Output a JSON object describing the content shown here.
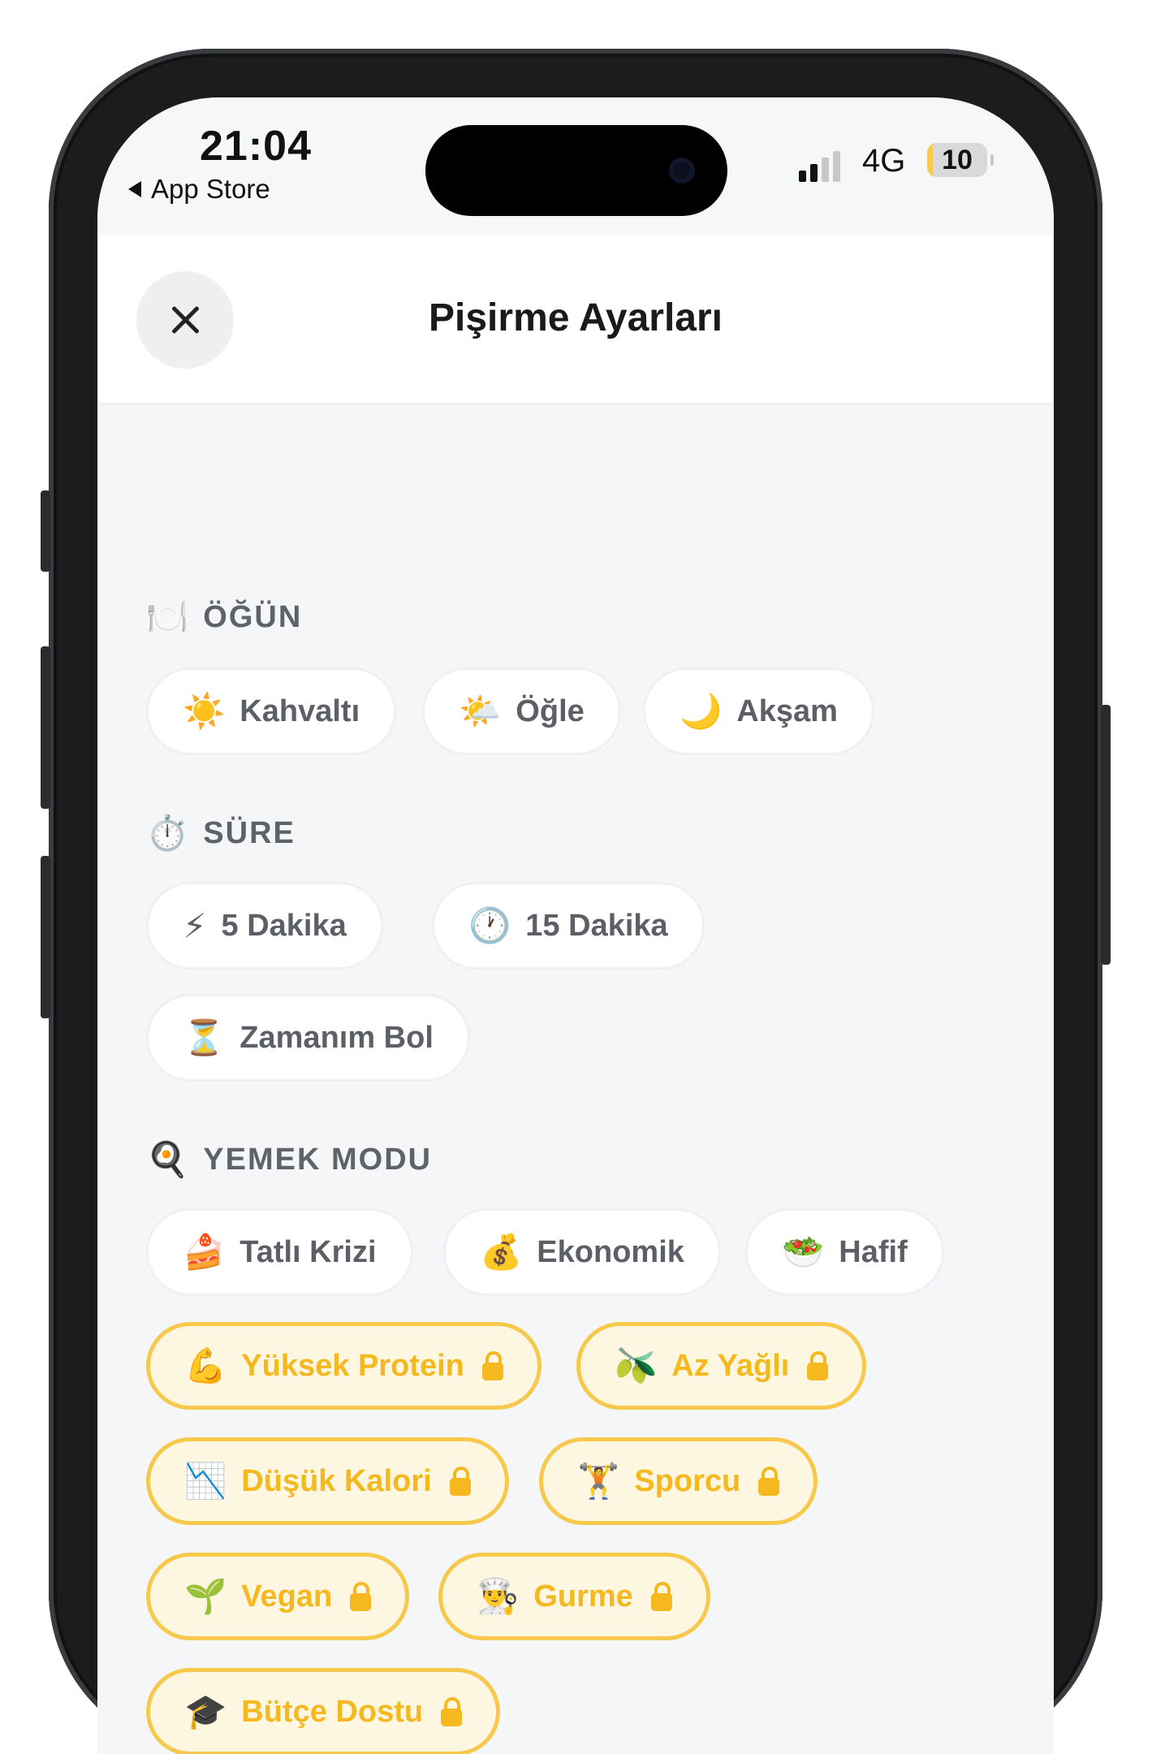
{
  "status": {
    "time": "21:04",
    "back_label": "App Store",
    "network": "4G",
    "battery": "10",
    "battery_level": 0.1,
    "signal_bars": 2
  },
  "header": {
    "title": "Pişirme Ayarları",
    "close_icon": "close-icon"
  },
  "sections": {
    "ogun": {
      "icon": "🍽️",
      "title": "ÖĞÜN",
      "chips": [
        {
          "icon": "☀️",
          "label": "Kahvaltı"
        },
        {
          "icon": "🌤️",
          "label": "Öğle"
        },
        {
          "icon": "🌙",
          "label": "Akşam"
        }
      ]
    },
    "sure": {
      "icon": "⏱️",
      "title": "SÜRE",
      "chips": [
        {
          "icon": "⚡",
          "label": "5 Dakika"
        },
        {
          "icon": "🕐",
          "label": "15 Dakika"
        },
        {
          "icon": "⏳",
          "label": "Zamanım Bol"
        }
      ]
    },
    "mod": {
      "icon": "🍳",
      "title": "YEMEK MODU",
      "chips": [
        {
          "icon": "🍰",
          "label": "Tatlı Krizi"
        },
        {
          "icon": "💰",
          "label": "Ekonomik"
        },
        {
          "icon": "🥗",
          "label": "Hafif"
        }
      ],
      "premium_chips": [
        {
          "icon": "💪",
          "label": "Yüksek Protein"
        },
        {
          "icon": "🫒",
          "label": "Az Yağlı"
        },
        {
          "icon": "📉",
          "label": "Düşük Kalori"
        },
        {
          "icon": "🏋️",
          "label": "Sporcu"
        },
        {
          "icon": "🌱",
          "label": "Vegan"
        },
        {
          "icon": "👨‍🍳",
          "label": "Gurme"
        },
        {
          "icon": "🎓",
          "label": "Bütçe Dostu"
        }
      ]
    }
  },
  "colors": {
    "premium_border": "#f6c94c",
    "premium_text": "#f5b81e",
    "premium_bg": "#fdf6e1",
    "chip_text": "#5c6066",
    "background": "#f5f6f8"
  }
}
